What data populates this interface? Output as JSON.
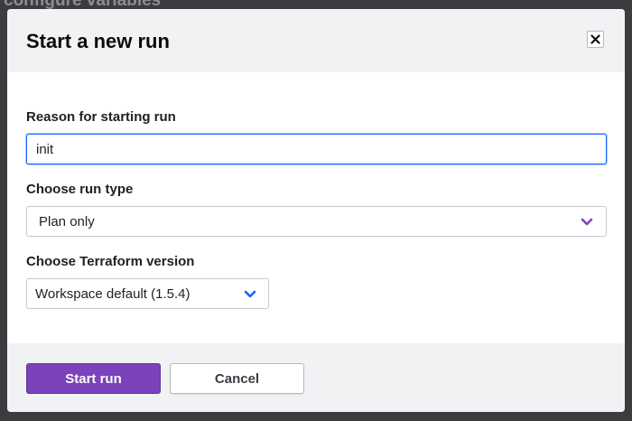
{
  "backdrop": {
    "page_text": "configure variables"
  },
  "modal": {
    "title": "Start a new run",
    "close_symbol": "×",
    "reason": {
      "label": "Reason for starting run",
      "value": "init"
    },
    "run_type": {
      "label": "Choose run type",
      "selected": "Plan only",
      "chevron_color": "#7b42bc"
    },
    "terraform_version": {
      "label": "Choose Terraform version",
      "selected": "Workspace default (1.5.4)",
      "chevron_color": "#1563ff"
    },
    "footer": {
      "start_label": "Start run",
      "cancel_label": "Cancel"
    }
  },
  "colors": {
    "primary": "#7b42bc",
    "focus": "#1563ff",
    "header_bg": "#f1f2f4"
  }
}
